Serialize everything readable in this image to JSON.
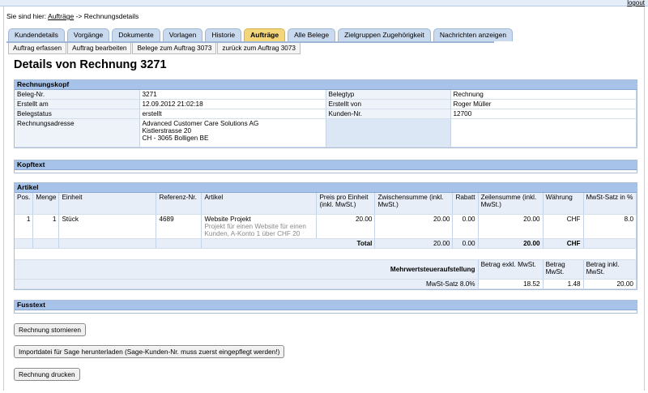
{
  "header": {
    "logout": "logout"
  },
  "breadcrumb": {
    "prefix": "Sie sind hier:",
    "link": "Aufträge",
    "separator": "->",
    "current": "Rechnungsdetails"
  },
  "tabs": [
    {
      "label": "Kundendetails"
    },
    {
      "label": "Vorgänge"
    },
    {
      "label": "Dokumente"
    },
    {
      "label": "Vorlagen"
    },
    {
      "label": "Historie"
    },
    {
      "label": "Aufträge"
    },
    {
      "label": "Alle Belege"
    },
    {
      "label": "Zielgruppen Zugehörigkeit"
    },
    {
      "label": "Nachrichten anzeigen"
    }
  ],
  "subtabs": [
    {
      "label": "Auftrag erfassen"
    },
    {
      "label": "Auftrag bearbeiten"
    },
    {
      "label": "Belege zum Auftrag 3073"
    },
    {
      "label": "zurück zum Auftrag 3073"
    }
  ],
  "page_title": "Details von Rechnung 3271",
  "rechnungskopf": {
    "title": "Rechnungskopf",
    "beleg_nr_label": "Beleg-Nr.",
    "beleg_nr": "3271",
    "belegtyp_label": "Belegtyp",
    "belegtyp": "Rechnung",
    "erstellt_am_label": "Erstellt am",
    "erstellt_am": "12.09.2012 21:02:18",
    "erstellt_von_label": "Erstellt von",
    "erstellt_von": "Roger Müller",
    "belegstatus_label": "Belegstatus",
    "belegstatus": "erstellt",
    "kunden_nr_label": "Kunden-Nr.",
    "kunden_nr": "12700",
    "adresse_label": "Rechnungsadresse",
    "adresse_1": "Advanced Customer Care Solutions AG",
    "adresse_2": "Kistlerstrasse 20",
    "adresse_3": "CH - 3065 Bolligen BE"
  },
  "kopftext": {
    "title": "Kopftext"
  },
  "artikel": {
    "title": "Artikel",
    "columns": {
      "pos": "Pos.",
      "menge": "Menge",
      "einheit": "Einheit",
      "referenz": "Referenz-Nr.",
      "artikel": "Artikel",
      "preis": "Preis pro Einheit (inkl. MwSt.)",
      "zwischensumme": "Zwischensumme (inkl. MwSt.)",
      "rabatt": "Rabatt",
      "zeilensumme": "Zeilensumme (inkl. MwSt.)",
      "waehrung": "Währung",
      "mwst_satz": "MwSt-Satz in %"
    },
    "rows": [
      {
        "pos": "1",
        "menge": "1",
        "einheit": "Stück",
        "referenz": "4689",
        "artikel": "Website Projekt",
        "beschreibung": "Projekt für einen Website für einen Kunden, A-Konto 1 über CHF 20",
        "preis": "20.00",
        "zwischensumme": "20.00",
        "rabatt": "0.00",
        "zeilensumme": "20.00",
        "waehrung": "CHF",
        "mwst_satz": "8.0"
      }
    ],
    "total": {
      "label": "Total",
      "zwischensumme": "20.00",
      "rabatt": "0.00",
      "zeilensumme": "20.00",
      "waehrung": "CHF"
    },
    "mwst": {
      "title": "Mehrwertsteueraufstellung",
      "col_exkl": "Betrag exkl. MwSt.",
      "col_betrag": "Betrag MwSt.",
      "col_inkl": "Betrag inkl. MwSt.",
      "row_label": "MwSt-Satz 8.0%",
      "exkl": "18.52",
      "betrag": "1.48",
      "inkl": "20.00"
    }
  },
  "fusstext": {
    "title": "Fusstext"
  },
  "buttons": {
    "stornieren": "Rechnung stornieren",
    "import": "Importdatei für Sage herunterladen (Sage-Kunden-Nr. muss zuerst eingepflegt werden!)",
    "drucken": "Rechnung drucken"
  }
}
